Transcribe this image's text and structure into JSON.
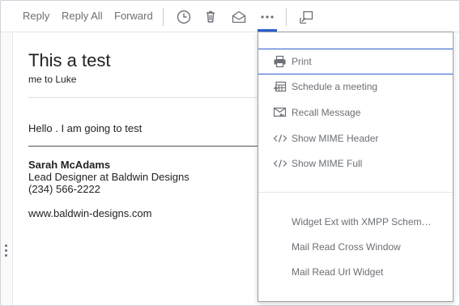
{
  "toolbar": {
    "reply_label": "Reply",
    "reply_all_label": "Reply All",
    "forward_label": "Forward",
    "icons": [
      "clock-icon",
      "trash-icon",
      "open-envelope-icon",
      "more-icon",
      "popout-icon"
    ]
  },
  "message": {
    "subject": "This a test",
    "from_to": "me to Luke",
    "body": "Hello . I am going to test",
    "signature": {
      "name": "Sarah McAdams",
      "title": "Lead Designer at Baldwin Designs",
      "phone": "(234) 566-2222",
      "website": "www.baldwin-designs.com"
    }
  },
  "menu": {
    "items": [
      {
        "label": "Print",
        "icon": "printer-icon"
      },
      {
        "label": "Schedule a meeting",
        "icon": "calendar-icon"
      },
      {
        "label": "Recall Message",
        "icon": "recall-icon"
      },
      {
        "label": "Show MIME Header",
        "icon": "code-icon"
      },
      {
        "label": "Show MIME Full",
        "icon": "code-icon"
      },
      {
        "label": "Widget Ext with XMPP Schem…"
      },
      {
        "label": "Mail Read Cross Window"
      },
      {
        "label": "Mail Read Url Widget"
      }
    ]
  },
  "colors": {
    "accent": "#2f5fd0",
    "muted_text": "#6b6f75",
    "text": "#222222"
  }
}
